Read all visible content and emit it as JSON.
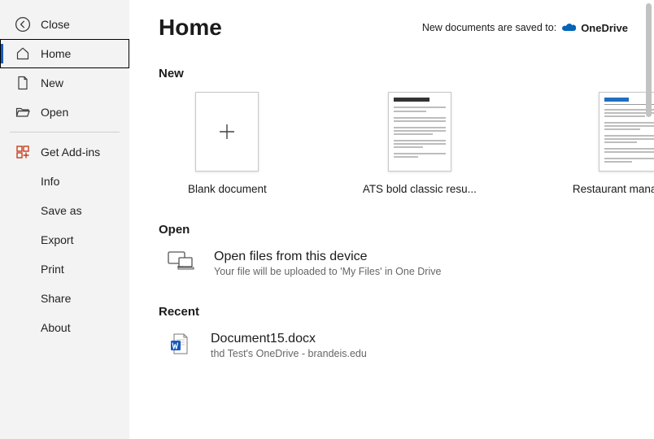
{
  "sidebar": {
    "close": "Close",
    "home": "Home",
    "new": "New",
    "open": "Open",
    "get_addins": "Get Add-ins",
    "info": "Info",
    "save_as": "Save as",
    "export": "Export",
    "print": "Print",
    "share": "Share",
    "about": "About"
  },
  "header": {
    "title": "Home",
    "save_location_prefix": "New documents are saved to:",
    "save_location_label": "OneDrive"
  },
  "sections": {
    "new": "New",
    "open": "Open",
    "recent": "Recent"
  },
  "templates": [
    {
      "label": "Blank document"
    },
    {
      "label": "ATS bold classic resu..."
    },
    {
      "label": "Restaurant manager r..."
    }
  ],
  "open": {
    "title": "Open files from this device",
    "subtitle": "Your file will be uploaded to 'My Files' in One Drive"
  },
  "recent": [
    {
      "name": "Document15.docx",
      "location": "thd Test's OneDrive - brandeis.edu"
    }
  ]
}
